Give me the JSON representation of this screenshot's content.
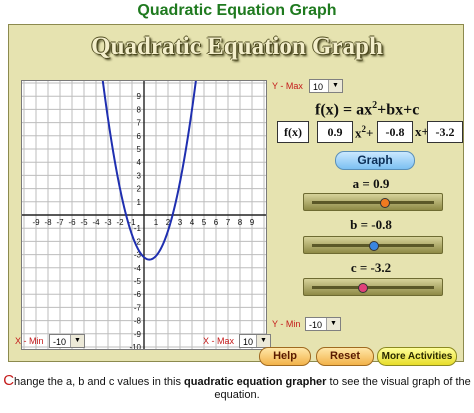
{
  "header": {
    "title": "Quadratic Equation Graph"
  },
  "panel": {
    "title": "Quadratic Equation Graph"
  },
  "graph": {
    "tick_labels_x": [
      "-9",
      "-8",
      "-7",
      "-6",
      "-5",
      "-4",
      "-3",
      "-2",
      "-1",
      "1",
      "2",
      "3",
      "4",
      "5",
      "6",
      "7",
      "8",
      "9"
    ],
    "tick_labels_y": [
      "9",
      "8",
      "7",
      "6",
      "5",
      "4",
      "3",
      "2",
      "1",
      "-1",
      "-2",
      "-3",
      "-4",
      "-5",
      "-6",
      "-7",
      "-8",
      "-9",
      "-10"
    ],
    "x_range": [
      -10,
      10
    ],
    "y_range": [
      -10,
      10
    ],
    "curve_color": "#1f2fb0"
  },
  "controls": {
    "ymax_label": "Y - Max",
    "ymax_value": "10",
    "ymin_label": "Y - Min",
    "ymin_value": "-10",
    "xmin_label": "X - Min",
    "xmin_value": "-10",
    "xmax_label": "X - Max",
    "xmax_value": "10"
  },
  "equation": {
    "formula_prefix": "f(x) = ax",
    "formula_sup": "2",
    "formula_suffix": "+bx+c",
    "fx_label": "f(x)",
    "a_value": "0.9",
    "b_value": "-0.8",
    "c_value": "-3.2",
    "x2_label": "x",
    "x2_sup": "2",
    "plus1": "+",
    "x_label": "x",
    "plus2": "+"
  },
  "buttons": {
    "graph": "Graph",
    "help": "Help",
    "reset": "Reset",
    "more": "More Activities"
  },
  "sliders": {
    "a_label": "a  =  0.9",
    "b_label": "b  =  -0.8",
    "c_label": "c  =  -3.2",
    "a_level": 0.6,
    "b_level": 0.5,
    "c_level": 0.4,
    "a_color": "#f07a20",
    "b_color": "#3a86e0",
    "c_color": "#e0407a"
  },
  "footer": {
    "first_letter": "C",
    "text_before": "hange the a, b and c values in this ",
    "text_bold": "quadratic equation grapher",
    "text_after": " to see the visual graph of the equation."
  }
}
